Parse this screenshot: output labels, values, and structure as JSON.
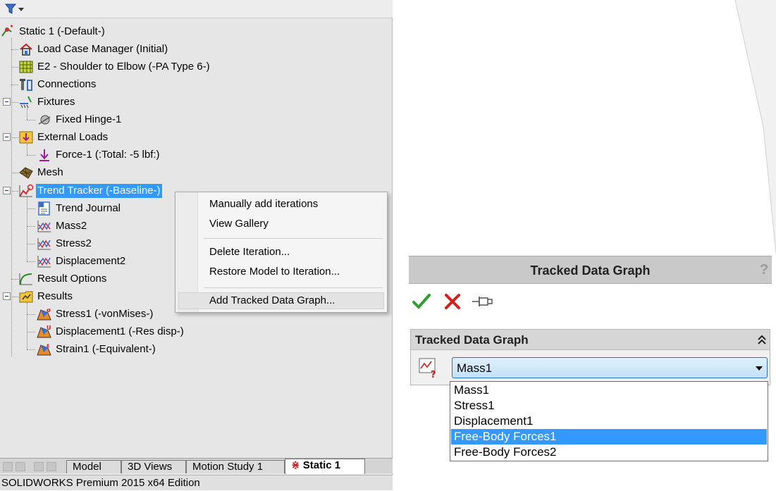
{
  "tree": {
    "root": "Static 1 (-Default-)",
    "items": [
      {
        "label": "Load Case Manager (Initial)"
      },
      {
        "label": "E2 - Shoulder to Elbow (-PA Type 6-)"
      },
      {
        "label": "Connections"
      },
      {
        "label": "Fixtures"
      },
      {
        "label": "Fixed Hinge-1"
      },
      {
        "label": "External Loads"
      },
      {
        "label": "Force-1 (:Total: -5 lbf:)"
      },
      {
        "label": "Mesh"
      },
      {
        "label": "Trend Tracker (-Baseline-)"
      },
      {
        "label": "Trend Journal"
      },
      {
        "label": "Mass2"
      },
      {
        "label": "Stress2"
      },
      {
        "label": "Displacement2"
      },
      {
        "label": "Result Options"
      },
      {
        "label": "Results"
      },
      {
        "label": "Stress1 (-vonMises-)"
      },
      {
        "label": "Displacement1 (-Res disp-)"
      },
      {
        "label": "Strain1 (-Equivalent-)"
      }
    ]
  },
  "context_menu": {
    "items": [
      {
        "label": "Manually add iterations"
      },
      {
        "label": "View Gallery"
      },
      {
        "label": "Delete Iteration..."
      },
      {
        "label": "Restore Model to Iteration..."
      },
      {
        "label": "Add Tracked Data Graph..."
      }
    ]
  },
  "tabs": {
    "items": [
      {
        "label": "Model"
      },
      {
        "label": "3D Views"
      },
      {
        "label": "Motion Study 1"
      },
      {
        "label": "Static 1"
      }
    ]
  },
  "status_bar": {
    "text": "SOLIDWORKS Premium 2015 x64 Edition"
  },
  "property_manager": {
    "title": "Tracked Data Graph",
    "help": "?",
    "group_title": "Tracked Data Graph",
    "selected_value": "Mass1",
    "options": [
      {
        "label": "Mass1"
      },
      {
        "label": "Stress1"
      },
      {
        "label": "Displacement1"
      },
      {
        "label": "Free-Body Forces1"
      },
      {
        "label": "Free-Body Forces2"
      }
    ]
  },
  "colors": {
    "selection": "#3399ff",
    "ok_green": "#2e9e2e",
    "cancel_red": "#d21f1f",
    "panel_bg": "#e6e6e6",
    "combo_border": "#2b73c2"
  },
  "icons": {
    "filter": "filter-icon",
    "ok": "checkmark-icon",
    "cancel": "x-icon",
    "pin": "pushpin-icon",
    "collapse": "double-chevron-up-icon",
    "graph": "graph-question-icon"
  }
}
